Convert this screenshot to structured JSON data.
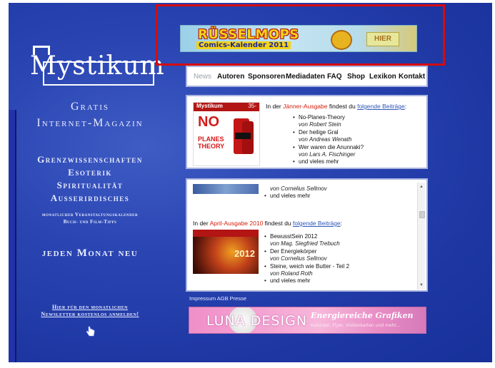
{
  "colors": {
    "page_background": "#1e37a3",
    "highlight_frame": "#d40c0c",
    "month_highlight": "#d4210d",
    "link_blue": "#2d56b8",
    "ad_pink": "#f4a3d2"
  },
  "sidebar": {
    "logo_text": "Mystikum",
    "gratis": "Gratis",
    "internet_magazin": "Internet-Magazin",
    "topics": [
      "Grenzwissenschaften",
      "Esoterik",
      "Spiritualität",
      "Ausserirdisches"
    ],
    "calendar_line1": "monatlicher Veranstaltungskalender",
    "calendar_line2": "Buch- und Film-Tipps",
    "jeden_monat": "jeden Monat neu",
    "newsletter_line1": "Hier für den monatlichen",
    "newsletter_line2": "Newsletter kostenlos anmelden!",
    "hand_icon": "pointing-hand-icon"
  },
  "top_banner": {
    "title": "RÜSSELMOPS",
    "subtitle": "Comics-Kalender 2011",
    "hier": "HIER"
  },
  "nav": {
    "items": [
      "News",
      "Autoren",
      "Sponsoren",
      "Mediadaten",
      "FAQ",
      "Shop",
      "Lexikon",
      "Kontakt"
    ]
  },
  "issue_jan": {
    "cover_masthead": "Mystikum",
    "cover_price": "35-",
    "cover_no": "NO",
    "cover_planes": "PLANES",
    "cover_theory": "THEORY",
    "prefix": "In der ",
    "month": "Jänner-Ausgabe",
    "middle": " findest du ",
    "link": "folgende Beiträge",
    "suffix": ":",
    "items": [
      {
        "title": "No-Planes-Theory",
        "author": "von Robert Stein"
      },
      {
        "title": "Der heilige Gral",
        "author": "von Andreas Wenath"
      },
      {
        "title": "Wer waren die Anunnaki?",
        "author": "von Lars A. Fischinger"
      },
      {
        "title": "und vieles mehr",
        "author": ""
      }
    ]
  },
  "issue_april": {
    "top_author": "von Cornelius Sellmov",
    "top_more": "und vieles mehr",
    "prefix": "In der ",
    "month": "April-Ausgabe 2010",
    "middle": " findest du ",
    "link": "folgende Beiträge",
    "suffix": ":",
    "cover_year": "2012",
    "items": [
      {
        "title": "BewusstSein 2012",
        "author": "von Mag. Siegfried Trebuch"
      },
      {
        "title": "Der Energiekörper",
        "author": "von Cornelius Sellmov"
      },
      {
        "title": "Steine, weich wie Butter - Teil 2",
        "author": "von Roland Roth"
      },
      {
        "title": "und vieles mehr",
        "author": ""
      }
    ]
  },
  "footer": {
    "links": "Impressum AGB Presse"
  },
  "luna_ad": {
    "brand": "LUNA DESIGN",
    "tagline": "Energiereiche Grafiken",
    "subline": "Kalender, Flyer, Visitenkarten und mehr..."
  }
}
